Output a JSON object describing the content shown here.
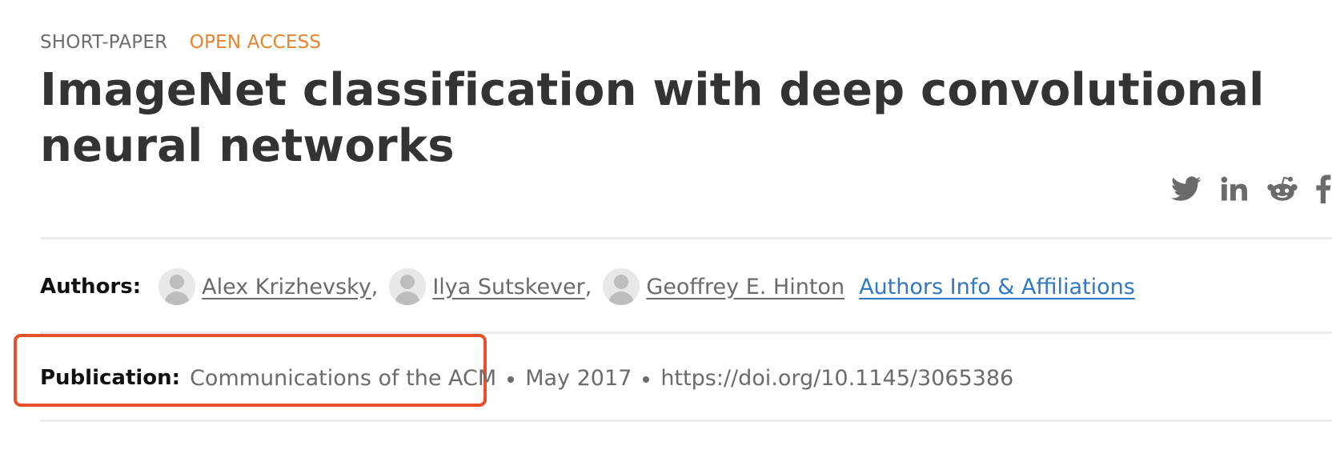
{
  "article": {
    "type_label": "SHORT-PAPER",
    "access_label": "OPEN ACCESS",
    "title": "ImageNet classification with deep convolutional neural networks"
  },
  "share": [
    {
      "name": "twitter",
      "icon": "twitter-icon"
    },
    {
      "name": "linkedin",
      "icon": "linkedin-icon"
    },
    {
      "name": "reddit",
      "icon": "reddit-icon"
    },
    {
      "name": "facebook",
      "icon": "facebook-icon"
    }
  ],
  "authors": {
    "label": "Authors:",
    "list": [
      {
        "name": "Alex Krizhevsky",
        "sep": ","
      },
      {
        "name": "Ilya Sutskever",
        "sep": ","
      },
      {
        "name": "Geoffrey E. Hinton",
        "sep": ""
      }
    ],
    "affiliations_link": "Authors Info & Affiliations"
  },
  "publication": {
    "label": "Publication:",
    "journal": "Communications of the ACM",
    "date": "May 2017",
    "doi": "https://doi.org/10.1145/3065386"
  },
  "colors": {
    "open_access": "#e6832f",
    "link": "#2f78c2",
    "highlight_box": "#e8502c"
  }
}
